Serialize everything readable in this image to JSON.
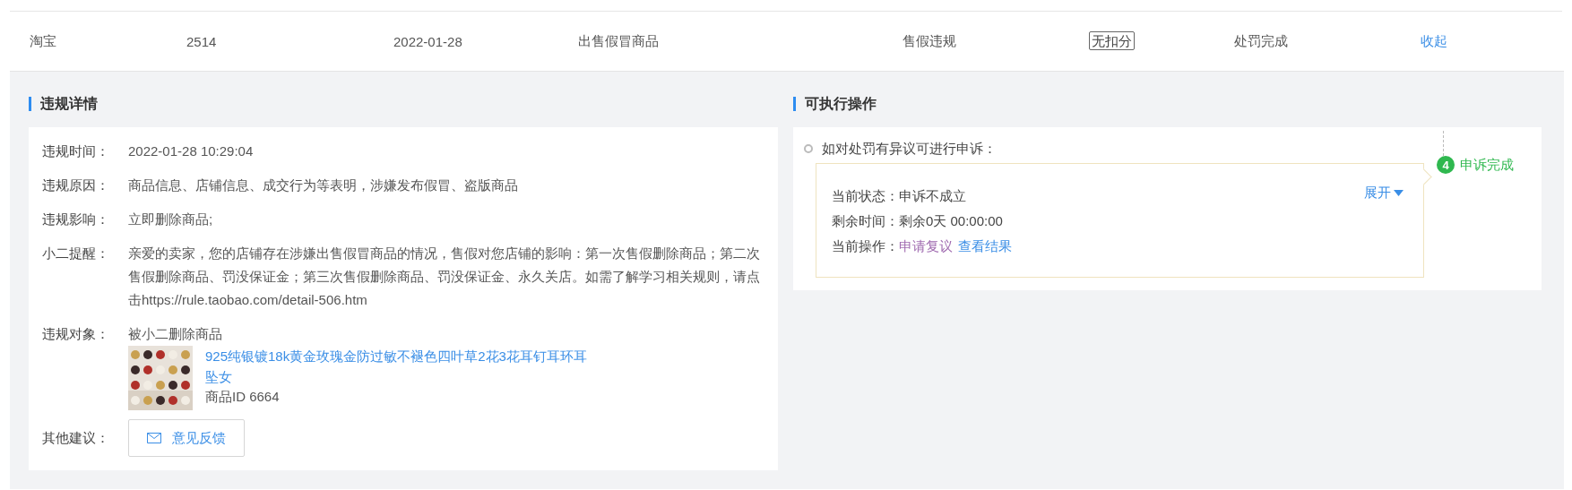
{
  "record_row": {
    "cells": [
      {
        "kind": "text",
        "text": "淘宝"
      },
      {
        "kind": "text",
        "text": "2514"
      },
      {
        "kind": "text",
        "text": "2022-01-28"
      },
      {
        "kind": "text",
        "text": "出售假冒商品"
      },
      {
        "kind": "text",
        "text": "售假违规"
      },
      {
        "kind": "tag",
        "text": "无扣分"
      },
      {
        "kind": "text",
        "text": "处罚完成"
      },
      {
        "kind": "link",
        "text": "收起"
      }
    ]
  },
  "violation_details": {
    "title": "违规详情",
    "fields": [
      {
        "label": "违规时间：",
        "value": "2022-01-28 10:29:04"
      },
      {
        "label": "违规原因：",
        "value": "商品信息、店铺信息、成交行为等表明，涉嫌发布假冒、盗版商品"
      },
      {
        "label": "违规影响：",
        "value": "立即删除商品;"
      },
      {
        "label": "小二提醒：",
        "value": "亲爱的卖家，您的店铺存在涉嫌出售假冒商品的情况，售假对您店铺的影响：第一次售假删除商品；第二次售假删除商品、罚没保证金；第三次售假删除商品、罚没保证金、永久关店。如需了解学习相关规则，请点击https://rule.taobao.com/detail-506.htm"
      }
    ],
    "object": {
      "label": "违规对象：",
      "value": "被小二删除商品",
      "product": {
        "kind": "picture",
        "title": "925纯银镀18k黄金玫瑰金防过敏不褪色四叶草2花3花耳钉耳环耳坠女",
        "id": "商品ID 6664"
      }
    },
    "suggestion": {
      "label": "其他建议：",
      "button": "意见反馈"
    }
  },
  "actions": {
    "title": "可执行操作",
    "prompt": "如对处罚有异议可进行申诉：",
    "fields": [
      {
        "label": "当前状态：",
        "value": "申诉不成立"
      },
      {
        "label": "剩余时间：",
        "value": "剩余0天 00:00:00"
      }
    ],
    "operations_label": "当前操作：",
    "operations": [
      {
        "text": "申请复议",
        "visited": true
      },
      {
        "text": "查看结果",
        "visited": false
      }
    ],
    "expand": "展开",
    "step": {
      "number": "4",
      "label": "申诉完成"
    }
  }
}
